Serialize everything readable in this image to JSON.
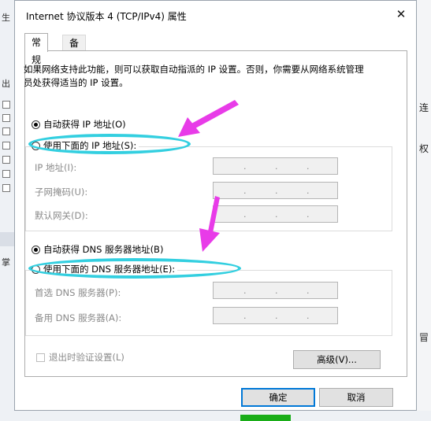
{
  "background": {
    "left_fragments": [
      "生",
      "出",
      "掌"
    ],
    "right_fragments": [
      "连",
      "权",
      "冒"
    ]
  },
  "dialog": {
    "title": "Internet 协议版本 4 (TCP/IPv4) 属性",
    "close_glyph": "✕",
    "tabs": [
      {
        "label": "常规",
        "active": true
      },
      {
        "label": "备用配置",
        "active": false
      }
    ],
    "description": "如果网络支持此功能，则可以获取自动指派的 IP 设置。否则，你需要从网络系统管理员处获得适当的 IP 设置。",
    "ip_section": {
      "auto_label": "自动获得 IP 地址(O)",
      "manual_label": "使用下面的 IP 地址(S):",
      "selected": "auto",
      "fields": [
        {
          "label": "IP 地址(I):",
          "value": ".   .   ."
        },
        {
          "label": "子网掩码(U):",
          "value": ".   .   ."
        },
        {
          "label": "默认网关(D):",
          "value": ".   .   ."
        }
      ]
    },
    "dns_section": {
      "auto_label": "自动获得 DNS 服务器地址(B)",
      "manual_label": "使用下面的 DNS 服务器地址(E):",
      "selected": "auto",
      "fields": [
        {
          "label": "首选 DNS 服务器(P):",
          "value": ".   .   ."
        },
        {
          "label": "备用 DNS 服务器(A):",
          "value": ".   .   ."
        }
      ]
    },
    "validate_label": "退出时验证设置(L)",
    "advanced_label": "高级(V)...",
    "ok_label": "确定",
    "cancel_label": "取消"
  },
  "colors": {
    "highlight_ellipse": "#33cfe0",
    "arrow": "#e83be8",
    "accent": "#0078d7"
  }
}
